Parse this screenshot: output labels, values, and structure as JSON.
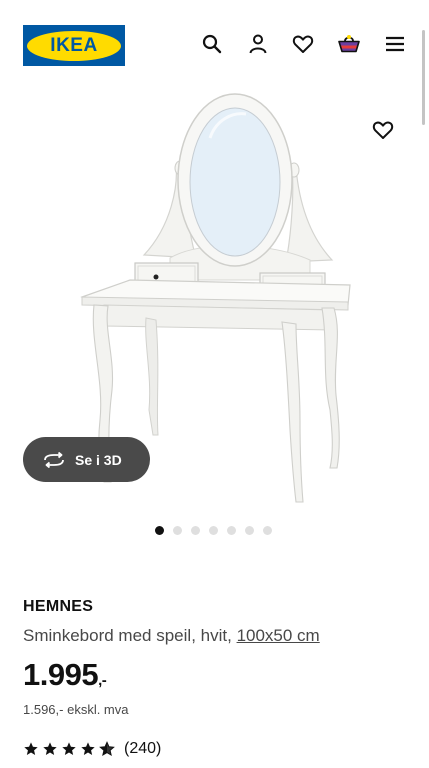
{
  "header": {
    "logo_text": "IKEA",
    "icons": [
      "search-icon",
      "account-icon",
      "favourites-icon",
      "cart-icon",
      "menu-icon"
    ]
  },
  "gallery": {
    "view_3d_label": "Se i 3D",
    "image_count": 7,
    "active_index": 0
  },
  "product": {
    "name": "HEMNES",
    "description": "Sminkebord med speil, hvit,",
    "size": "100x50 cm",
    "price_main": "1.995",
    "price_suffix": ",-",
    "price_ex_vat": "1.596,- ekskl. mva",
    "rating_stars": 4.5,
    "rating_count": "(240)"
  },
  "colors": {
    "brand_blue": "#0058a3",
    "brand_yellow": "#ffdb00",
    "button_dark": "#4a4a4a"
  }
}
